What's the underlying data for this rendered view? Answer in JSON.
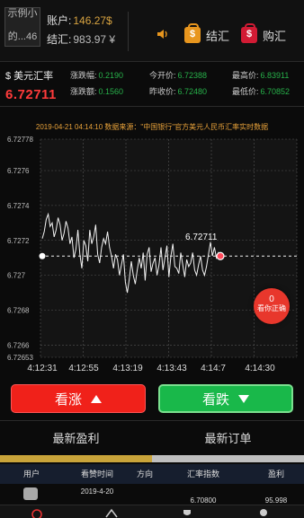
{
  "header": {
    "avatar_lines": [
      "示例小",
      "的...46"
    ],
    "account_label": "账户:",
    "account_value": "146.27$",
    "settle_label": "结汇:",
    "settle_value": "983.97 ¥",
    "settle_button": "结汇",
    "buy_button": "购汇"
  },
  "quote": {
    "symbol_name": "$ 美元汇率",
    "price": "6.72711",
    "stats": [
      {
        "label": "涨跌幅:",
        "value": "0.2190",
        "color": "green"
      },
      {
        "label": "今开价:",
        "value": "6.72388",
        "color": "green"
      },
      {
        "label": "最高价:",
        "value": "6.83911",
        "color": "green"
      },
      {
        "label": "涨跌额:",
        "value": "0.1560",
        "color": "green"
      },
      {
        "label": "昨收价:",
        "value": "6.72480",
        "color": "green"
      },
      {
        "label": "最低价:",
        "value": "6.70852",
        "color": "green"
      }
    ]
  },
  "chart_data": {
    "type": "line",
    "title": "2019-04-21 04:14:10 数据来源：\"中国银行\"官方美元人民币汇率实时数据",
    "y_ticks": [
      "6.72778",
      "6.7276",
      "6.7274",
      "6.7272",
      "6.727",
      "6.7268",
      "6.7266",
      "6.72653"
    ],
    "x_ticks": [
      "4:12:31",
      "4:12:55",
      "4:13:19",
      "4:13:43",
      "4:14:7",
      "4:14:30"
    ],
    "ylim": [
      6.72653,
      6.72778
    ],
    "current_value_label": "6.72711",
    "current_value": 6.72711,
    "series": [
      {
        "values": [
          6.72721,
          6.72725,
          6.72732,
          6.72735,
          6.72728,
          6.7273,
          6.72722,
          6.72726,
          6.72733,
          6.72729,
          6.7272,
          6.72724,
          6.72731,
          6.72727,
          6.72718,
          6.72722,
          6.7271,
          6.72715,
          6.72726,
          6.72712,
          6.72704,
          6.7272,
          6.72717,
          6.72708,
          6.72726,
          6.72718,
          6.72722,
          6.72729,
          6.72712,
          6.72707,
          6.72716,
          6.72721,
          6.72718,
          6.72725,
          6.72716,
          6.72711,
          6.72704,
          6.72712,
          6.72709,
          6.727,
          6.72706,
          6.72712,
          6.72696,
          6.7269,
          6.72698,
          6.72708,
          6.727,
          6.72695,
          6.72703,
          6.7271,
          6.72704,
          6.72713,
          6.72697,
          6.72712,
          6.72716,
          6.72702,
          6.72707,
          6.7271,
          6.727,
          6.72706,
          6.72716,
          6.72703,
          6.7271,
          6.72717,
          6.72699,
          6.72711,
          6.72718,
          6.72705,
          6.72704,
          6.72701,
          6.72713,
          6.72706,
          6.72699,
          6.72709,
          6.72705,
          6.72707,
          6.72713,
          6.72703,
          6.727,
          6.72706,
          6.72711,
          6.72703,
          6.727,
          6.72705,
          6.72712,
          6.72719,
          6.72711,
          6.72716,
          6.7271,
          6.72713,
          6.72711
        ]
      }
    ]
  },
  "badge": {
    "count": "0",
    "label": "看你正确"
  },
  "buttons": {
    "up": "看涨",
    "down": "看跌"
  },
  "tabs": {
    "profit": "最新盈利",
    "orders": "最新订单"
  },
  "table": {
    "headers": [
      "用户",
      "看赞时间",
      "方向",
      "汇率指数",
      "盈利"
    ],
    "row": {
      "time": "2019-4-20",
      "direction": "",
      "index": "6.70800",
      "profit": "95.998"
    }
  },
  "colors": {
    "accent_gold": "#d9a441",
    "up_red": "#f0211a",
    "down_green": "#19b84a"
  }
}
